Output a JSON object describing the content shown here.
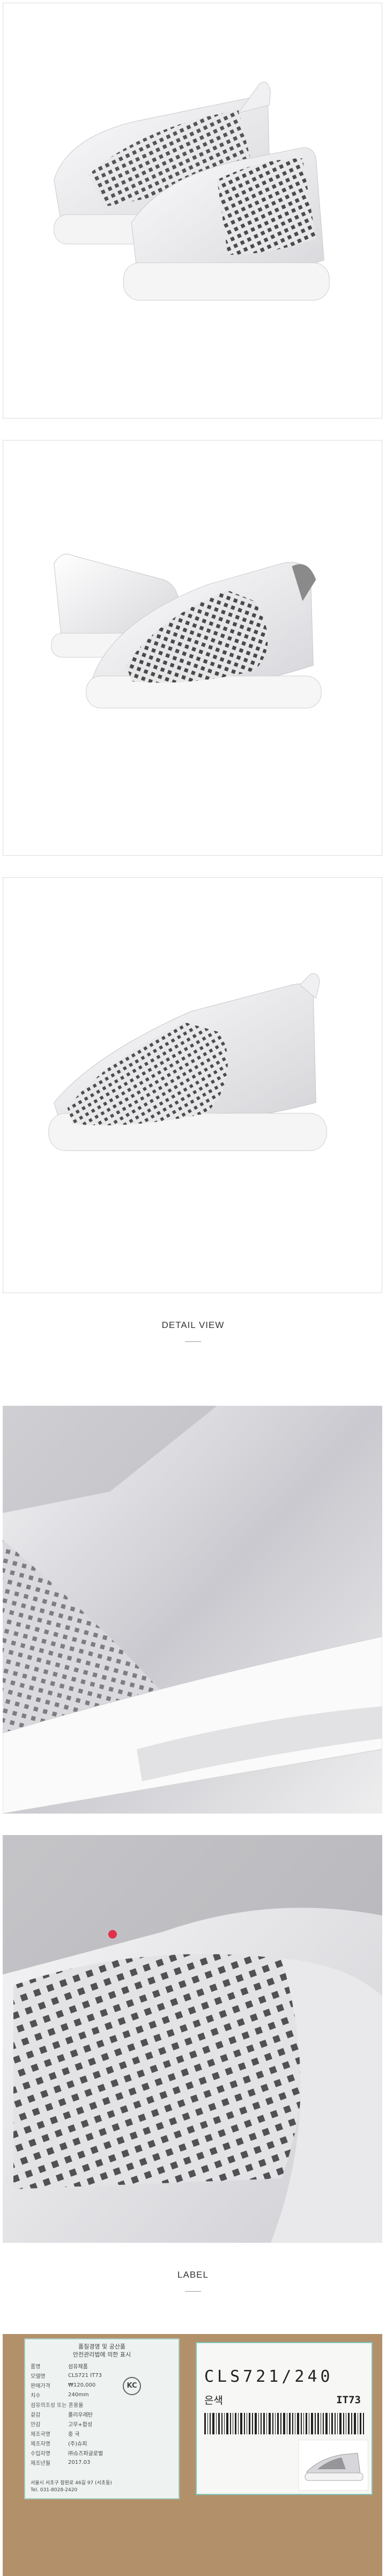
{
  "sections": {
    "detail_title": "DETAIL VIEW",
    "label_title": "LABEL"
  },
  "sticker": {
    "heading_line1": "품질경영 및 공산품",
    "heading_line2": "안전관리법에 의한 표시",
    "rows": [
      {
        "k": "품명",
        "v": "섬유제품"
      },
      {
        "k": "모델명",
        "v": "CLS721 IT73"
      },
      {
        "k": "판매가격",
        "v": "₩120,000"
      },
      {
        "k": "치수",
        "v": "240mm"
      },
      {
        "k": "섬유의조성 또는 혼용율",
        "v": ""
      },
      {
        "k": "겉감",
        "v": "폴리우레탄"
      },
      {
        "k": "안감",
        "v": "고무+합성"
      },
      {
        "k": "제조국명",
        "v": "중 국"
      },
      {
        "k": "제조자명",
        "v": "(주)슈피"
      },
      {
        "k": "수입자명",
        "v": "㈜슈즈파글로벌"
      },
      {
        "k": "제조년월",
        "v": "2017.03"
      }
    ],
    "kc_mark": "KC",
    "footer_line1": "서울시 서초구 잠원로 46길 97 (서초동)",
    "footer_line2": "Tel. 031-8028-2420"
  },
  "box_label": {
    "code": "CLS721/240",
    "color_text": "은색",
    "sub_code": "IT73"
  },
  "colors": {
    "background": "#ffffff",
    "frame_border": "#dcdcdc",
    "label_board": "#b2916a",
    "sticker_border": "#a7c9c2"
  }
}
